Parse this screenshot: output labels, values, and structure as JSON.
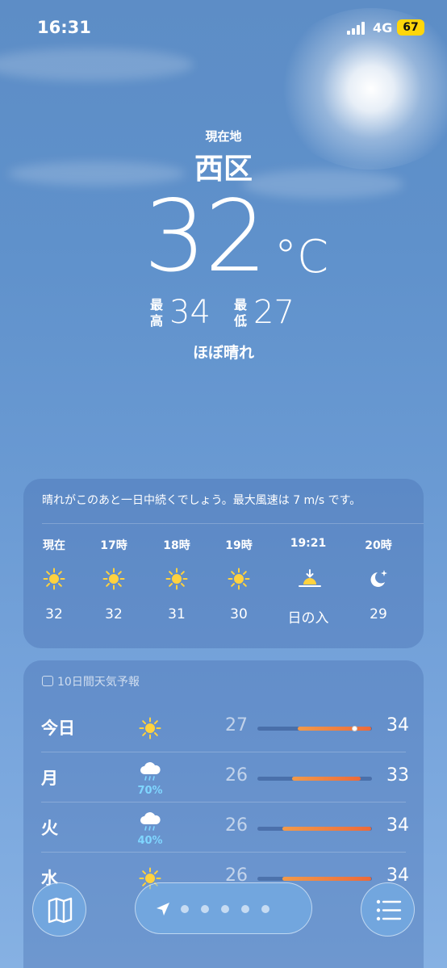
{
  "status_bar": {
    "time": "16:31",
    "network": "4G",
    "battery": "67"
  },
  "location": {
    "label": "現在地",
    "city": "西区"
  },
  "current": {
    "temperature": "32",
    "unit": "°C",
    "high_label": "最高",
    "high": "34",
    "low_label": "最低",
    "low": "27",
    "condition": "ほぼ晴れ"
  },
  "hourly": {
    "summary": "晴れがこのあと一日中続くでしょう。最大風速は 7 m/s です。",
    "items": [
      {
        "time": "現在",
        "icon": "sun-icon",
        "temp": "32"
      },
      {
        "time": "17時",
        "icon": "sun-icon",
        "temp": "32"
      },
      {
        "time": "18時",
        "icon": "sun-icon",
        "temp": "31"
      },
      {
        "time": "19時",
        "icon": "sun-icon",
        "temp": "30"
      },
      {
        "time": "19:21",
        "icon": "sunset-icon",
        "temp": "日の入"
      },
      {
        "time": "20時",
        "icon": "moon-stars-icon",
        "temp": "29"
      }
    ]
  },
  "daily": {
    "header": "10日間天気予報",
    "days": [
      {
        "day": "今日",
        "icon": "sun-icon",
        "precip": "",
        "low": "27",
        "high": "34",
        "range_start": 0.35,
        "range_end": 0.99,
        "current_pos": 0.85
      },
      {
        "day": "月",
        "icon": "rain-cloud-icon",
        "precip": "70%",
        "low": "26",
        "high": "33",
        "range_start": 0.3,
        "range_end": 0.9
      },
      {
        "day": "火",
        "icon": "rain-cloud-icon",
        "precip": "40%",
        "low": "26",
        "high": "34",
        "range_start": 0.22,
        "range_end": 0.99
      },
      {
        "day": "水",
        "icon": "sun-icon",
        "precip": "",
        "low": "26",
        "high": "34",
        "range_start": 0.22,
        "range_end": 0.99
      }
    ]
  },
  "toolbar": {
    "map_icon": "map-icon",
    "location_icon": "location-arrow-icon",
    "list_icon": "list-icon",
    "pages": 6
  },
  "colors": {
    "accent_bar_start": "#f29a4a",
    "accent_bar_end": "#ec6a3a",
    "precip": "#7fd6ff",
    "battery": "#ffd60a"
  }
}
